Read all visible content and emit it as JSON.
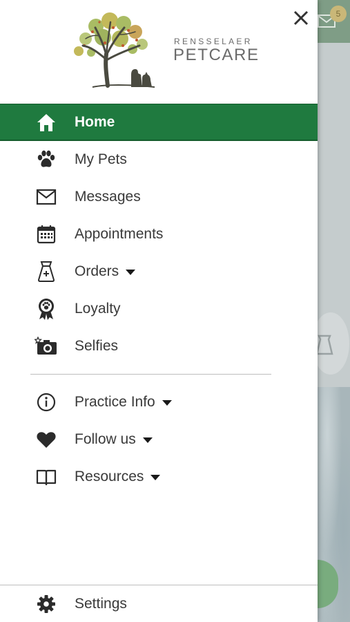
{
  "logo": {
    "line1": "RENSSELAER",
    "line2": "PETCARE"
  },
  "background": {
    "badge_count": "5"
  },
  "menu": {
    "primary": [
      {
        "label": "Home",
        "icon": "home-icon",
        "active": true
      },
      {
        "label": "My Pets",
        "icon": "paw-icon"
      },
      {
        "label": "Messages",
        "icon": "envelope-icon"
      },
      {
        "label": "Appointments",
        "icon": "calendar-icon"
      },
      {
        "label": "Orders",
        "icon": "food-bag-icon",
        "dropdown": true
      },
      {
        "label": "Loyalty",
        "icon": "ribbon-award-icon"
      },
      {
        "label": "Selfies",
        "icon": "camera-icon"
      }
    ],
    "secondary": [
      {
        "label": "Practice Info",
        "icon": "info-icon",
        "dropdown": true
      },
      {
        "label": "Follow us",
        "icon": "heart-icon",
        "dropdown": true
      },
      {
        "label": "Resources",
        "icon": "book-icon",
        "dropdown": true
      }
    ]
  },
  "footer": {
    "settings_label": "Settings",
    "icon": "gear-icon"
  },
  "colors": {
    "active_bg": "#1f7a3f",
    "text": "#3a3a3a",
    "icon": "#2b2b2b"
  }
}
